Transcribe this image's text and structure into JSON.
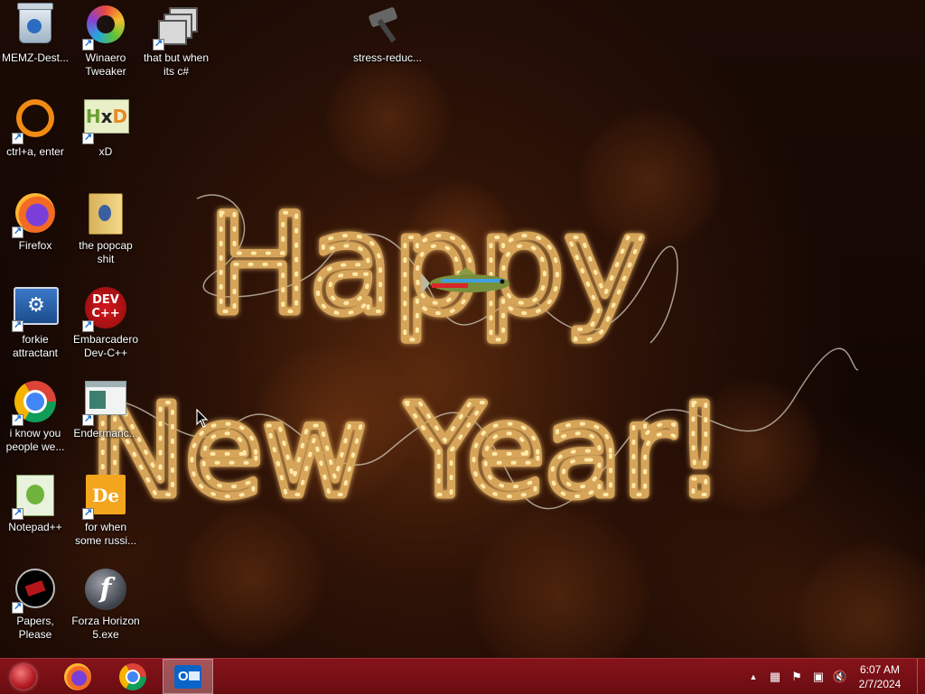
{
  "desktop": {
    "icons": [
      {
        "id": "recycle-bin",
        "label": "MEMZ-Dest...",
        "shortcut": false
      },
      {
        "id": "winaero",
        "label": "Winaero Tweaker",
        "shortcut": true
      },
      {
        "id": "that-but",
        "label": "that but when its c#",
        "shortcut": true
      },
      {
        "id": "stress",
        "label": "stress-reduc...",
        "shortcut": false
      },
      {
        "id": "ctrl-a",
        "label": "ctrl+a, enter",
        "shortcut": true
      },
      {
        "id": "xd",
        "label": "xD",
        "shortcut": true
      },
      {
        "id": "firefox",
        "label": "Firefox",
        "shortcut": true
      },
      {
        "id": "popcap",
        "label": "the popcap shit",
        "shortcut": false
      },
      {
        "id": "forkie",
        "label": "forkie attractant",
        "shortcut": true
      },
      {
        "id": "devcpp",
        "label": "Embarcadero Dev-C++",
        "shortcut": true
      },
      {
        "id": "chrome",
        "label": "i know you people we...",
        "shortcut": true
      },
      {
        "id": "endermanch",
        "label": "Endermanc...",
        "shortcut": true
      },
      {
        "id": "notepadpp",
        "label": "Notepad++",
        "shortcut": true
      },
      {
        "id": "for-when",
        "label": "for when some russi...",
        "shortcut": true
      },
      {
        "id": "papers",
        "label": "Papers, Please",
        "shortcut": true
      },
      {
        "id": "forza",
        "label": "Forza Horizon 5.exe",
        "shortcut": false
      }
    ]
  },
  "wallpaper": {
    "line1": "Happy",
    "line2": "New Year!"
  },
  "icon_art": {
    "hxd_h": "H",
    "hxd_x": "x",
    "hxd_d": "D",
    "devcpp_line1": "DEV",
    "devcpp_line2": "C++",
    "dexe_d": "D",
    "dexe_e": "e",
    "flash_f": "f",
    "outlook_o": "O"
  },
  "taskbar": {
    "pinned": [
      {
        "name": "Firefox"
      },
      {
        "name": "Google Chrome"
      },
      {
        "name": "Outlook",
        "active": true
      }
    ],
    "tray_icons": [
      "chevron-up-icon",
      "network-taskmgr-icon",
      "action-center-flag-icon",
      "network-icon",
      "volume-muted-icon"
    ],
    "tray_glyphs": {
      "chevron": "▲",
      "network_taskmgr": "▦",
      "flag": "⚑",
      "network": "▣",
      "volume": "🔇"
    },
    "time": "6:07 AM",
    "date": "2/7/2024"
  },
  "colors": {
    "taskbar": "#7a1016",
    "light_bulb": "#ffe9a8",
    "tube": "#d6a55a"
  }
}
